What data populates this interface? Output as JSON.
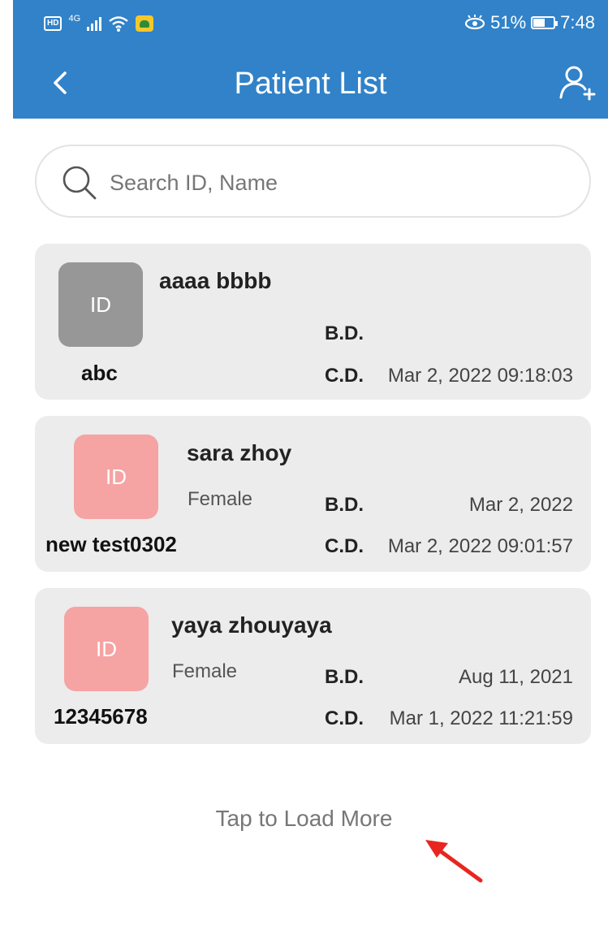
{
  "status_bar": {
    "hd": "HD",
    "network": "4G",
    "battery_percent": "51%",
    "time": "7:48"
  },
  "nav": {
    "title": "Patient List",
    "back_icon": "chevron-left-icon",
    "add_icon": "add-user-icon"
  },
  "search": {
    "placeholder": "Search ID, Name",
    "value": ""
  },
  "patients": [
    {
      "name": "aaaa bbbb",
      "avatar_text": "ID",
      "avatar_color": "#979797",
      "gender": "",
      "id": "abc",
      "bd_label": "B.D.",
      "bd_value": "",
      "cd_label": "C.D.",
      "cd_value": "Mar 2, 2022 09:18:03"
    },
    {
      "name": "sara zhoy",
      "avatar_text": "ID",
      "avatar_color": "#f6a3a3",
      "gender": "Female",
      "id": "new test0302",
      "bd_label": "B.D.",
      "bd_value": "Mar 2, 2022",
      "cd_label": "C.D.",
      "cd_value": "Mar 2, 2022 09:01:57"
    },
    {
      "name": "yaya zhouyaya",
      "avatar_text": "ID",
      "avatar_color": "#f6a3a3",
      "gender": "Female",
      "id": "12345678",
      "bd_label": "B.D.",
      "bd_value": "Aug 11, 2021",
      "cd_label": "C.D.",
      "cd_value": "Mar 1, 2022 11:21:59"
    }
  ],
  "load_more": "Tap to Load More",
  "colors": {
    "header": "#3182c8",
    "card": "#ececec",
    "annotation_arrow": "#e8261f"
  }
}
